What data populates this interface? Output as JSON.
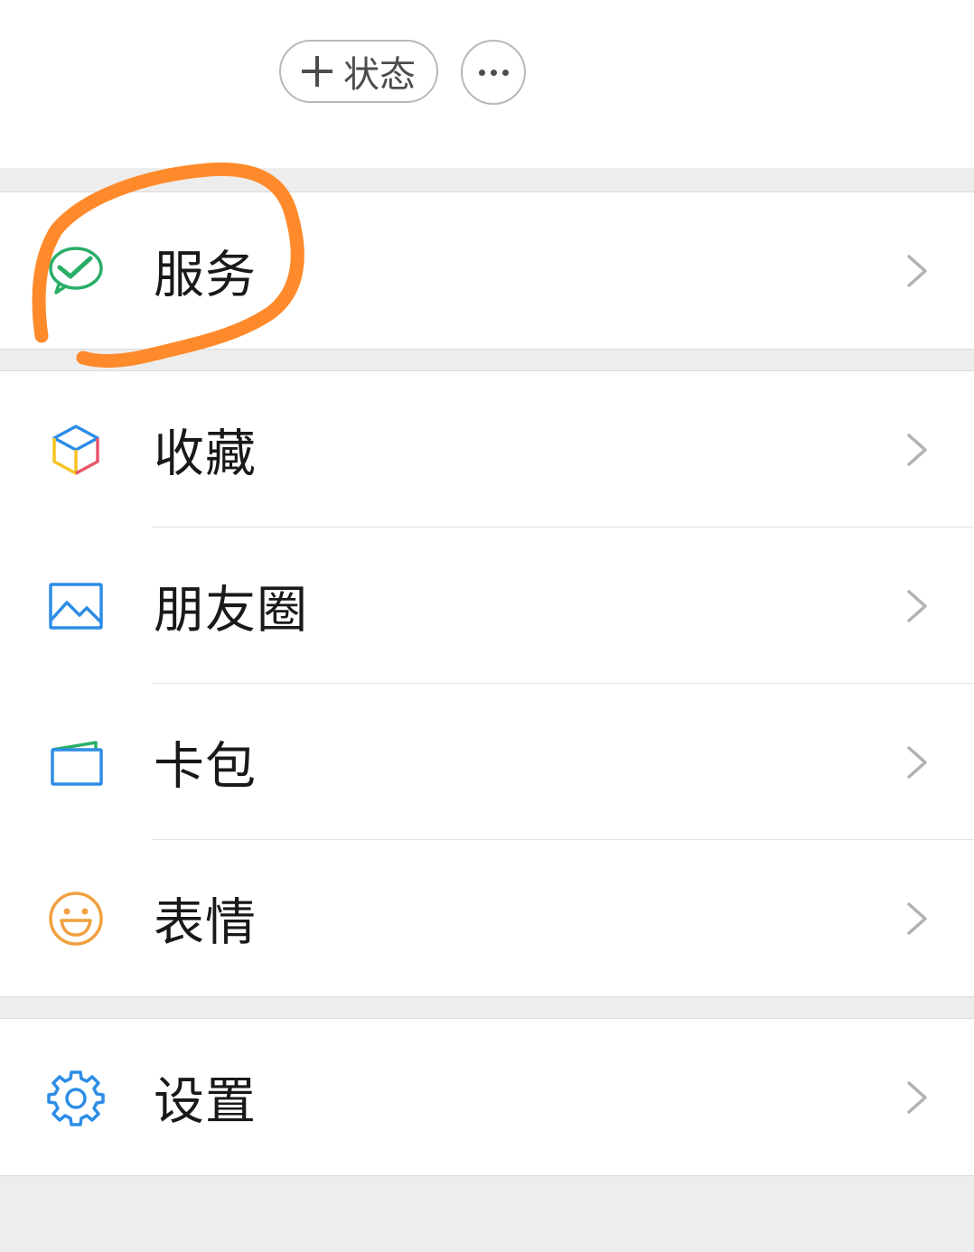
{
  "header": {
    "status_button_label": "状态"
  },
  "menu": {
    "service": {
      "label": "服务",
      "icon": "wechat-pay-icon"
    },
    "favorites": {
      "label": "收藏",
      "icon": "cube-icon"
    },
    "moments": {
      "label": "朋友圈",
      "icon": "picture-icon"
    },
    "cards": {
      "label": "卡包",
      "icon": "card-wallet-icon"
    },
    "stickers": {
      "label": "表情",
      "icon": "smiley-icon"
    },
    "settings": {
      "label": "设置",
      "icon": "gear-icon"
    }
  },
  "colors": {
    "green": "#2aae67",
    "blue": "#2d8de6",
    "orange": "#f0a040",
    "annotation": "#ff8a2b"
  }
}
